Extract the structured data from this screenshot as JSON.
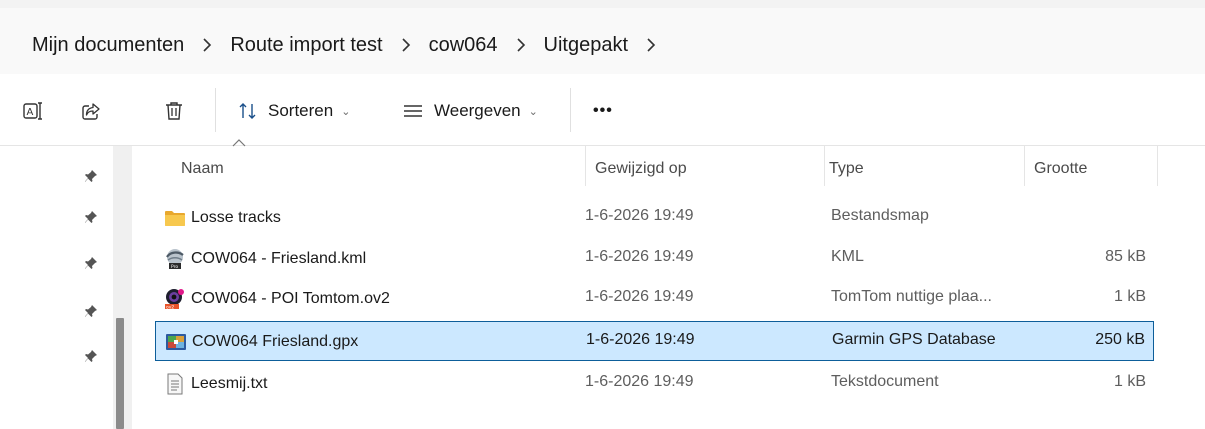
{
  "breadcrumb": {
    "items": [
      "Mijn documenten",
      "Route import test",
      "cow064",
      "Uitgepakt"
    ]
  },
  "toolbar": {
    "sort_label": "Sorteren",
    "view_label": "Weergeven",
    "more_label": "•••",
    "chevron": "⌄"
  },
  "columns": {
    "name": "Naam",
    "date": "Gewijzigd op",
    "type": "Type",
    "size": "Grootte"
  },
  "files": [
    {
      "name": "Losse tracks",
      "date": "1-6-2026 19:49",
      "type": "Bestandsmap",
      "size": "",
      "icon": "folder-icon"
    },
    {
      "name": "COW064 - Friesland.kml",
      "date": "1-6-2026 19:49",
      "type": "KML",
      "size": "85 kB",
      "icon": "kml-file-icon"
    },
    {
      "name": "COW064 - POI Tomtom.ov2",
      "date": "1-6-2026 19:49",
      "type": "TomTom nuttige plaa...",
      "size": "1 kB",
      "icon": "tomtom-file-icon"
    },
    {
      "name": "COW064 Friesland.gpx",
      "date": "1-6-2026 19:49",
      "type": "Garmin GPS Database",
      "size": "250 kB",
      "icon": "gpx-file-icon",
      "selected": true
    },
    {
      "name": "Leesmij.txt",
      "date": "1-6-2026 19:49",
      "type": "Tekstdocument",
      "size": "1 kB",
      "icon": "text-file-icon"
    }
  ],
  "colors": {
    "selection_bg": "#cce8ff",
    "selection_border": "#0d5e9a",
    "folder": "#f4c24d"
  }
}
